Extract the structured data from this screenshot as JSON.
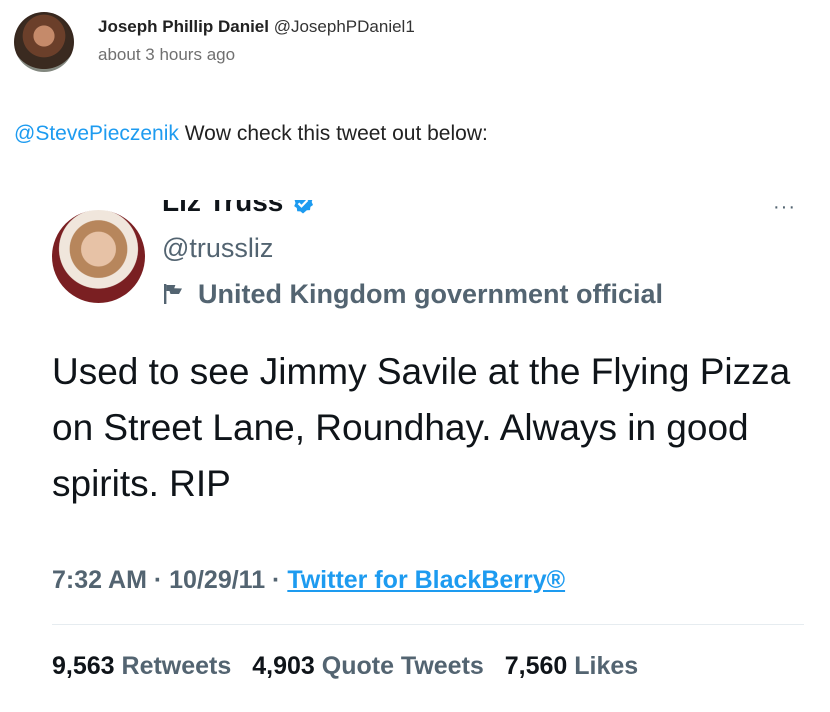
{
  "post": {
    "author_name": "Joseph Phillip Daniel",
    "author_handle": "@JosephPDaniel1",
    "timestamp": "about 3 hours ago",
    "mention": "@StevePieczenik",
    "text": " Wow check this tweet out below:"
  },
  "embedded_tweet": {
    "name": "Liz Truss",
    "handle": "@trussliz",
    "affiliation": "United Kingdom government official",
    "body": "Used to see Jimmy Savile at the Flying Pizza on Street Lane, Roundhay. Always in good spirits. RIP",
    "time": "7:32 AM",
    "separator": " · ",
    "date": "10/29/11",
    "source": "Twitter for BlackBerry®",
    "stats": {
      "retweets_count": "9,563",
      "retweets_label": "Retweets",
      "quotes_count": "4,903",
      "quotes_label": "Quote Tweets",
      "likes_count": "7,560",
      "likes_label": "Likes"
    },
    "more_glyph": "···"
  },
  "colors": {
    "accent": "#1d9bf0",
    "muted": "#536471",
    "text": "#0f1419"
  },
  "icons": {
    "verified": "verified-badge-icon",
    "affiliation": "flag-icon",
    "more": "more-options-icon"
  }
}
